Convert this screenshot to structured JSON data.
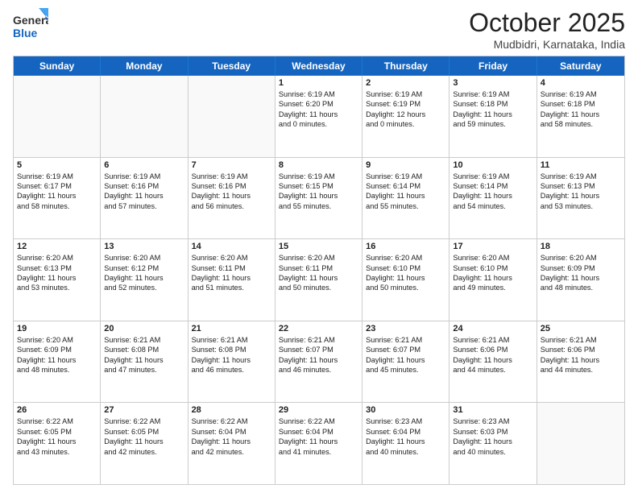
{
  "header": {
    "logo_general": "General",
    "logo_blue": "Blue",
    "title": "October 2025",
    "location": "Mudbidri, Karnataka, India"
  },
  "days_of_week": [
    "Sunday",
    "Monday",
    "Tuesday",
    "Wednesday",
    "Thursday",
    "Friday",
    "Saturday"
  ],
  "weeks": [
    [
      {
        "day": "",
        "info": [],
        "empty": true
      },
      {
        "day": "",
        "info": [],
        "empty": true
      },
      {
        "day": "",
        "info": [],
        "empty": true
      },
      {
        "day": "1",
        "info": [
          "Sunrise: 6:19 AM",
          "Sunset: 6:20 PM",
          "Daylight: 11 hours",
          "and 0 minutes."
        ],
        "empty": false
      },
      {
        "day": "2",
        "info": [
          "Sunrise: 6:19 AM",
          "Sunset: 6:19 PM",
          "Daylight: 12 hours",
          "and 0 minutes."
        ],
        "empty": false
      },
      {
        "day": "3",
        "info": [
          "Sunrise: 6:19 AM",
          "Sunset: 6:18 PM",
          "Daylight: 11 hours",
          "and 59 minutes."
        ],
        "empty": false
      },
      {
        "day": "4",
        "info": [
          "Sunrise: 6:19 AM",
          "Sunset: 6:18 PM",
          "Daylight: 11 hours",
          "and 58 minutes."
        ],
        "empty": false
      }
    ],
    [
      {
        "day": "5",
        "info": [
          "Sunrise: 6:19 AM",
          "Sunset: 6:17 PM",
          "Daylight: 11 hours",
          "and 58 minutes."
        ],
        "empty": false
      },
      {
        "day": "6",
        "info": [
          "Sunrise: 6:19 AM",
          "Sunset: 6:16 PM",
          "Daylight: 11 hours",
          "and 57 minutes."
        ],
        "empty": false
      },
      {
        "day": "7",
        "info": [
          "Sunrise: 6:19 AM",
          "Sunset: 6:16 PM",
          "Daylight: 11 hours",
          "and 56 minutes."
        ],
        "empty": false
      },
      {
        "day": "8",
        "info": [
          "Sunrise: 6:19 AM",
          "Sunset: 6:15 PM",
          "Daylight: 11 hours",
          "and 55 minutes."
        ],
        "empty": false
      },
      {
        "day": "9",
        "info": [
          "Sunrise: 6:19 AM",
          "Sunset: 6:14 PM",
          "Daylight: 11 hours",
          "and 55 minutes."
        ],
        "empty": false
      },
      {
        "day": "10",
        "info": [
          "Sunrise: 6:19 AM",
          "Sunset: 6:14 PM",
          "Daylight: 11 hours",
          "and 54 minutes."
        ],
        "empty": false
      },
      {
        "day": "11",
        "info": [
          "Sunrise: 6:19 AM",
          "Sunset: 6:13 PM",
          "Daylight: 11 hours",
          "and 53 minutes."
        ],
        "empty": false
      }
    ],
    [
      {
        "day": "12",
        "info": [
          "Sunrise: 6:20 AM",
          "Sunset: 6:13 PM",
          "Daylight: 11 hours",
          "and 53 minutes."
        ],
        "empty": false
      },
      {
        "day": "13",
        "info": [
          "Sunrise: 6:20 AM",
          "Sunset: 6:12 PM",
          "Daylight: 11 hours",
          "and 52 minutes."
        ],
        "empty": false
      },
      {
        "day": "14",
        "info": [
          "Sunrise: 6:20 AM",
          "Sunset: 6:11 PM",
          "Daylight: 11 hours",
          "and 51 minutes."
        ],
        "empty": false
      },
      {
        "day": "15",
        "info": [
          "Sunrise: 6:20 AM",
          "Sunset: 6:11 PM",
          "Daylight: 11 hours",
          "and 50 minutes."
        ],
        "empty": false
      },
      {
        "day": "16",
        "info": [
          "Sunrise: 6:20 AM",
          "Sunset: 6:10 PM",
          "Daylight: 11 hours",
          "and 50 minutes."
        ],
        "empty": false
      },
      {
        "day": "17",
        "info": [
          "Sunrise: 6:20 AM",
          "Sunset: 6:10 PM",
          "Daylight: 11 hours",
          "and 49 minutes."
        ],
        "empty": false
      },
      {
        "day": "18",
        "info": [
          "Sunrise: 6:20 AM",
          "Sunset: 6:09 PM",
          "Daylight: 11 hours",
          "and 48 minutes."
        ],
        "empty": false
      }
    ],
    [
      {
        "day": "19",
        "info": [
          "Sunrise: 6:20 AM",
          "Sunset: 6:09 PM",
          "Daylight: 11 hours",
          "and 48 minutes."
        ],
        "empty": false
      },
      {
        "day": "20",
        "info": [
          "Sunrise: 6:21 AM",
          "Sunset: 6:08 PM",
          "Daylight: 11 hours",
          "and 47 minutes."
        ],
        "empty": false
      },
      {
        "day": "21",
        "info": [
          "Sunrise: 6:21 AM",
          "Sunset: 6:08 PM",
          "Daylight: 11 hours",
          "and 46 minutes."
        ],
        "empty": false
      },
      {
        "day": "22",
        "info": [
          "Sunrise: 6:21 AM",
          "Sunset: 6:07 PM",
          "Daylight: 11 hours",
          "and 46 minutes."
        ],
        "empty": false
      },
      {
        "day": "23",
        "info": [
          "Sunrise: 6:21 AM",
          "Sunset: 6:07 PM",
          "Daylight: 11 hours",
          "and 45 minutes."
        ],
        "empty": false
      },
      {
        "day": "24",
        "info": [
          "Sunrise: 6:21 AM",
          "Sunset: 6:06 PM",
          "Daylight: 11 hours",
          "and 44 minutes."
        ],
        "empty": false
      },
      {
        "day": "25",
        "info": [
          "Sunrise: 6:21 AM",
          "Sunset: 6:06 PM",
          "Daylight: 11 hours",
          "and 44 minutes."
        ],
        "empty": false
      }
    ],
    [
      {
        "day": "26",
        "info": [
          "Sunrise: 6:22 AM",
          "Sunset: 6:05 PM",
          "Daylight: 11 hours",
          "and 43 minutes."
        ],
        "empty": false
      },
      {
        "day": "27",
        "info": [
          "Sunrise: 6:22 AM",
          "Sunset: 6:05 PM",
          "Daylight: 11 hours",
          "and 42 minutes."
        ],
        "empty": false
      },
      {
        "day": "28",
        "info": [
          "Sunrise: 6:22 AM",
          "Sunset: 6:04 PM",
          "Daylight: 11 hours",
          "and 42 minutes."
        ],
        "empty": false
      },
      {
        "day": "29",
        "info": [
          "Sunrise: 6:22 AM",
          "Sunset: 6:04 PM",
          "Daylight: 11 hours",
          "and 41 minutes."
        ],
        "empty": false
      },
      {
        "day": "30",
        "info": [
          "Sunrise: 6:23 AM",
          "Sunset: 6:04 PM",
          "Daylight: 11 hours",
          "and 40 minutes."
        ],
        "empty": false
      },
      {
        "day": "31",
        "info": [
          "Sunrise: 6:23 AM",
          "Sunset: 6:03 PM",
          "Daylight: 11 hours",
          "and 40 minutes."
        ],
        "empty": false
      },
      {
        "day": "",
        "info": [],
        "empty": true
      }
    ]
  ]
}
